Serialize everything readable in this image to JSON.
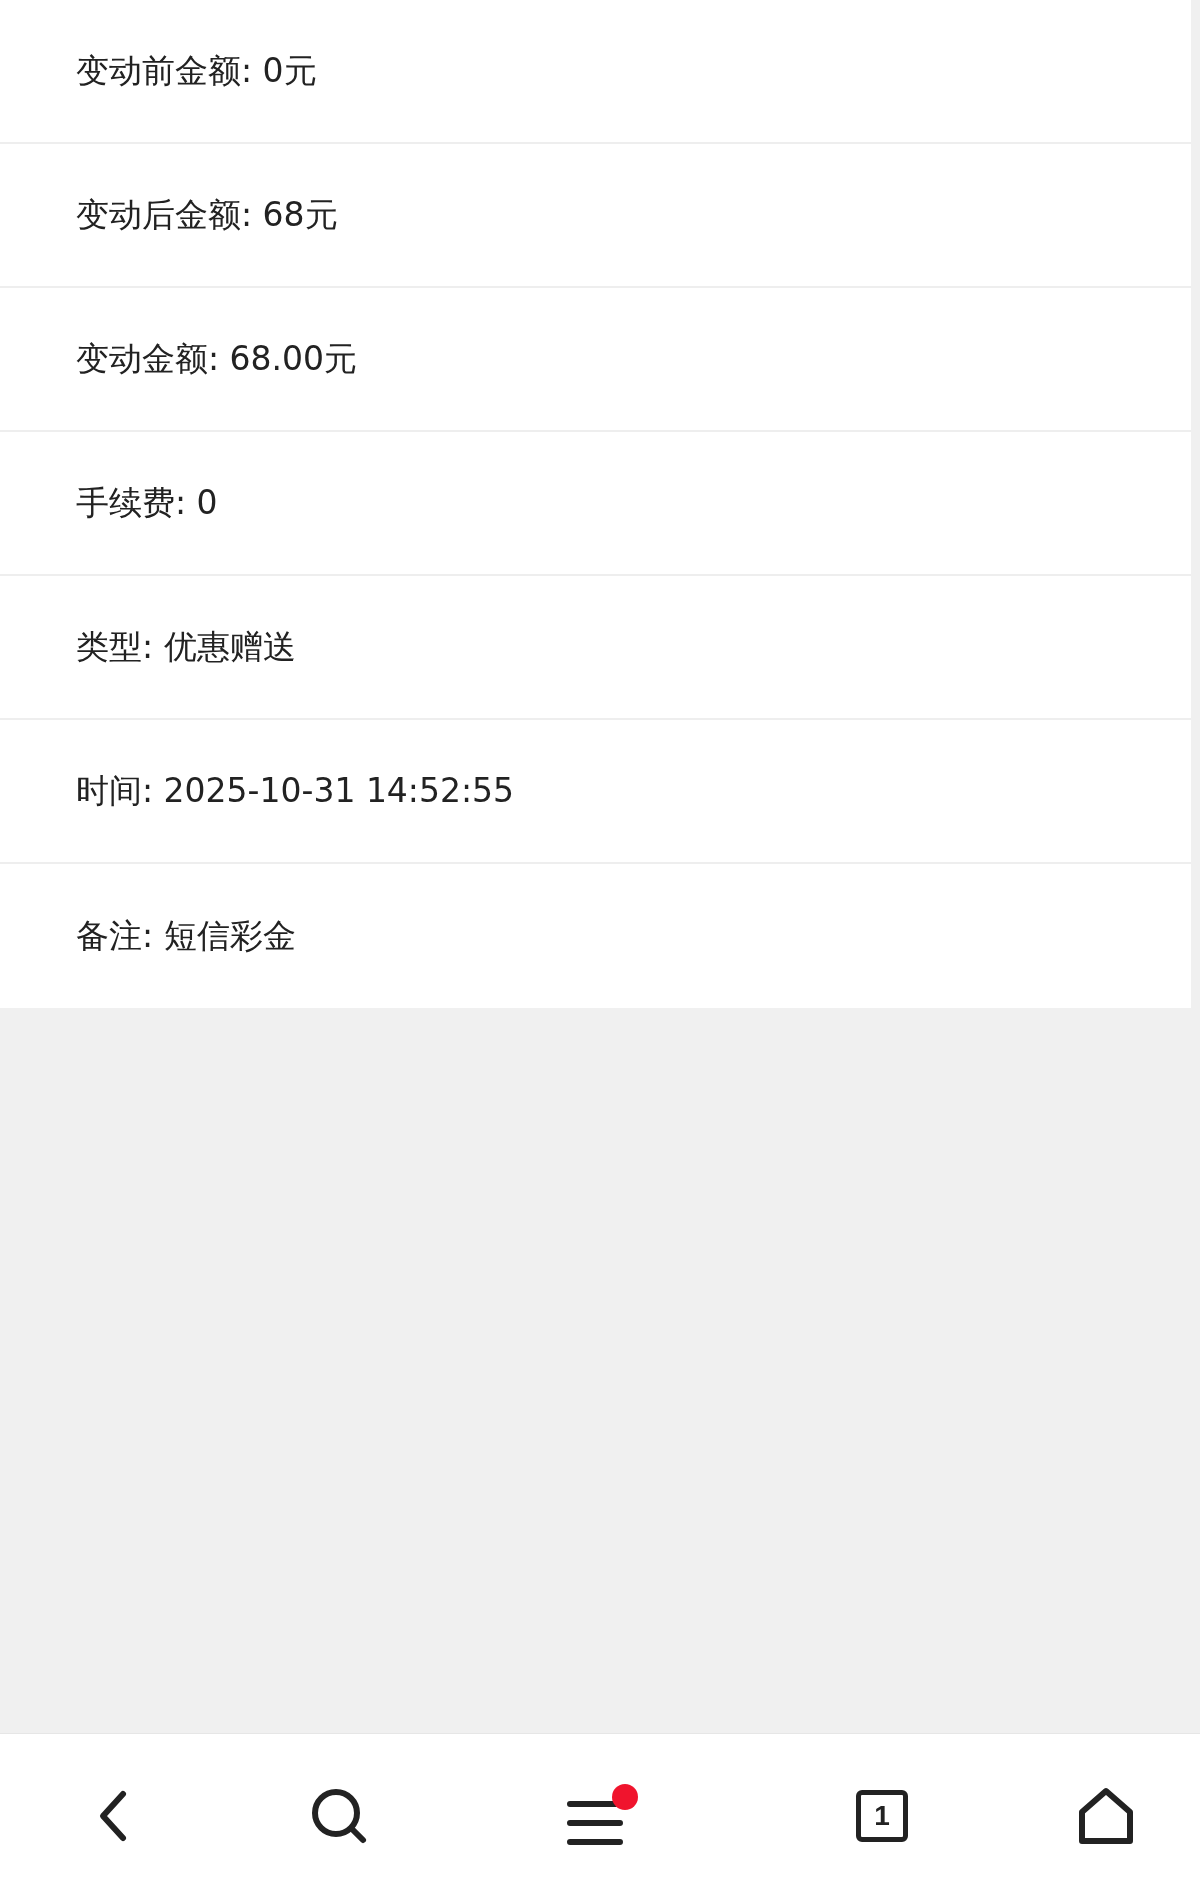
{
  "details": [
    {
      "text": "变动前金额: 0元"
    },
    {
      "text": "变动后金额: 68元"
    },
    {
      "text": "变动金额: 68.00元"
    },
    {
      "text": "手续费: 0"
    },
    {
      "text": "类型: 优惠赠送"
    },
    {
      "text": "时间: 2025-10-31 14:52:55"
    },
    {
      "text": "备注: 短信彩金"
    }
  ],
  "bottom_nav": [
    {
      "kind": "back"
    },
    {
      "kind": "search"
    },
    {
      "kind": "menu",
      "badge": true
    },
    {
      "kind": "tabs",
      "count": "1"
    },
    {
      "kind": "home"
    }
  ]
}
